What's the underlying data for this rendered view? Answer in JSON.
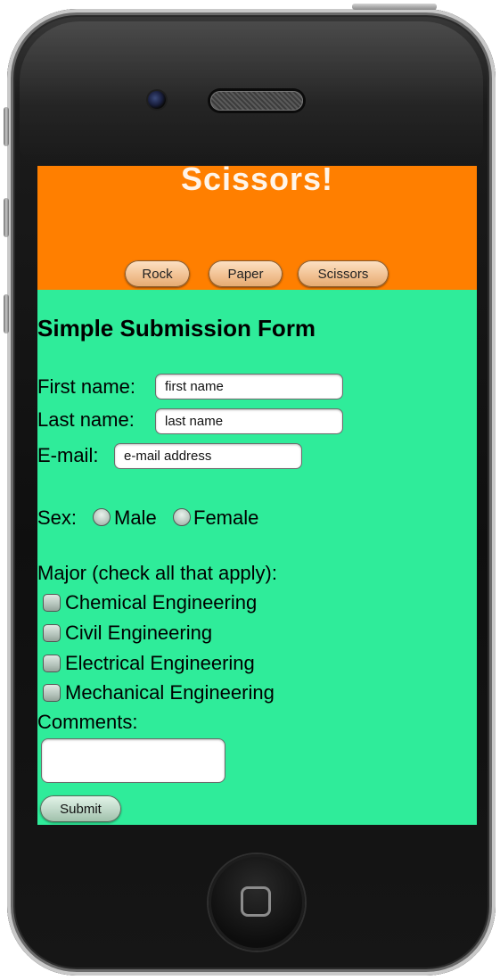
{
  "header": {
    "title": "Scissors!",
    "nav": [
      "Rock",
      "Paper",
      "Scissors"
    ],
    "color": "#ff7f00"
  },
  "form": {
    "title": "Simple Submission Form",
    "first_name": {
      "label": "First name:",
      "value": "first name"
    },
    "last_name": {
      "label": "Last name:",
      "value": "last name"
    },
    "email": {
      "label": "E-mail:",
      "value": "e-mail address"
    },
    "sex": {
      "label": "Sex:",
      "options": [
        "Male",
        "Female"
      ]
    },
    "major": {
      "label": "Major (check all that apply):",
      "options": [
        "Chemical Engineering",
        "Civil Engineering",
        "Electrical Engineering",
        "Mechanical Engineering"
      ]
    },
    "comments": {
      "label": "Comments:",
      "value": ""
    },
    "submit_label": "Submit"
  },
  "colors": {
    "background": "#2fec9a",
    "header": "#ff7f00"
  }
}
